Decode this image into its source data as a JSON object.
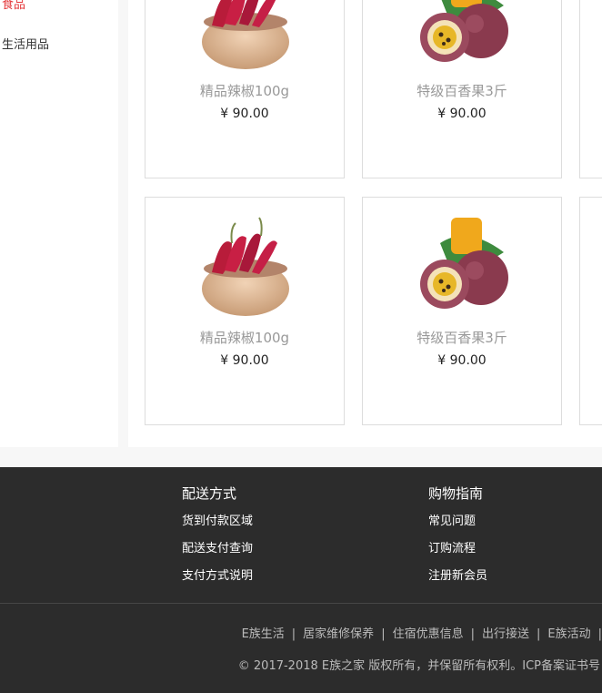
{
  "sidebar": {
    "items": [
      {
        "label": "食品",
        "active": true
      },
      {
        "label": "生活用品",
        "active": false
      }
    ]
  },
  "products": [
    {
      "name": "精品辣椒100g",
      "price": "¥ 90.00",
      "image": "chili-bowl"
    },
    {
      "name": "特级百香果3斤",
      "price": "¥ 90.00",
      "image": "passion-fruit"
    },
    {
      "name": "精品辣椒100g",
      "price": "¥ 90.00",
      "image": "chili-bowl"
    },
    {
      "name": "特级百香果3斤",
      "price": "¥ 90.00",
      "image": "passion-fruit"
    }
  ],
  "footer": {
    "columns": [
      {
        "title": "配送方式",
        "links": [
          "货到付款区域",
          "配送支付查询",
          "支付方式说明"
        ]
      },
      {
        "title": "购物指南",
        "links": [
          "常见问题",
          "订购流程",
          "注册新会员"
        ]
      }
    ],
    "bottom_links": [
      "E族生活",
      "居家维修保养",
      "住宿优惠信息",
      "出行接送",
      "E族活动"
    ],
    "copyright": "© 2017-2018 E族之家 版权所有，并保留所有权利。ICP备案证书号"
  },
  "colors": {
    "accent": "#e4393c",
    "footer_bg": "#2c2c2c"
  }
}
